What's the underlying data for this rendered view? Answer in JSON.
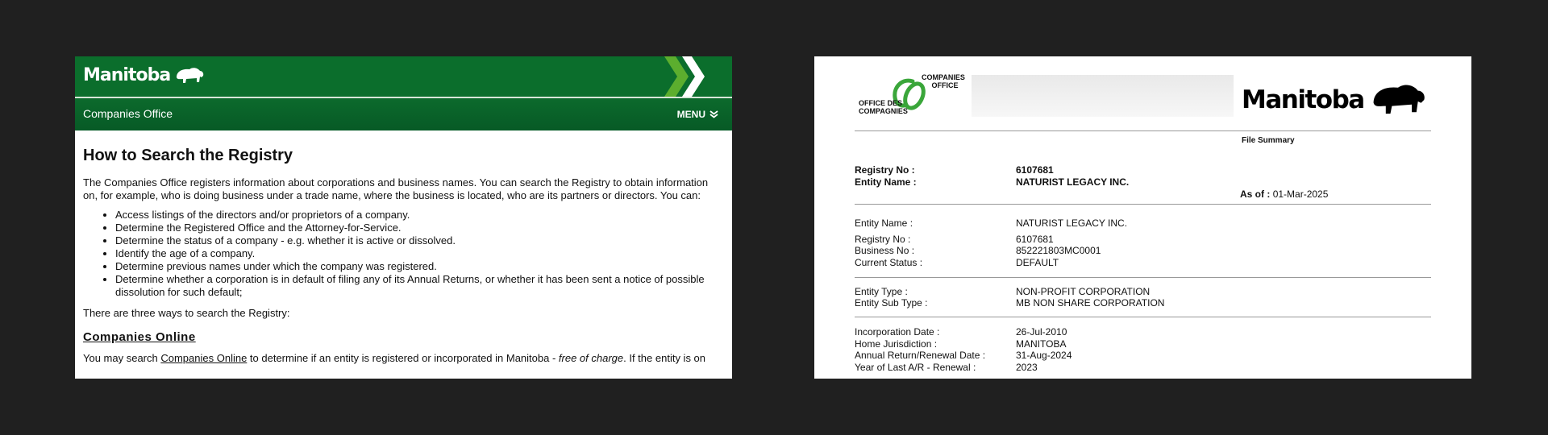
{
  "left": {
    "header": {
      "logo_text": "Manitoba",
      "section_title": "Companies Office",
      "menu_label": "MENU"
    },
    "heading": "How to Search the Registry",
    "intro": "The Companies Office registers information about corporations and business names. You can search the Registry to obtain information on, for example, who is doing business under a trade name, where the business is located, who are its partners or directors. You can:",
    "list": [
      "Access listings of the directors and/or proprietors of a company.",
      "Determine the Registered Office and the Attorney-for-Service.",
      "Determine the status of a company - e.g. whether it is active or dissolved.",
      "Identify the age of a company.",
      "Determine previous names under which the company was registered.",
      "Determine whether a corporation is in default of filing any of its Annual Returns, or whether it has been sent a notice of possible dissolution for such default;"
    ],
    "three_ways": "There are three ways to search the Registry:",
    "section_heading": "Companies Online",
    "online_para": {
      "before": "You may search ",
      "link": "Companies Online",
      "middle": " to determine if an entity is registered or incorporated in Manitoba - ",
      "italic": "free of charge",
      "after": ". If the entity is on"
    }
  },
  "right": {
    "logo": {
      "companies_office": "COMPANIES\nOFFICE",
      "office_des": "OFFICE DES\nCOMPAGNIES",
      "manitoba": "Manitoba"
    },
    "file_summary": "File Summary",
    "top": {
      "registry_label": "Registry No :",
      "registry_value": "6107681",
      "entity_label": "Entity Name :",
      "entity_value": "NATURIST LEGACY INC.",
      "as_of_label": "As of :",
      "as_of_value": "01-Mar-2025"
    },
    "details": {
      "entity_name_label": "Entity Name :",
      "entity_name_value": "NATURIST LEGACY INC.",
      "registry_label": "Registry No :",
      "registry_value": "6107681",
      "business_label": "Business No :",
      "business_value": "852221803MC0001",
      "status_label": "Current Status :",
      "status_value": "DEFAULT",
      "type_label": "Entity Type :",
      "type_value": "NON-PROFIT CORPORATION",
      "subtype_label": "Entity Sub Type :",
      "subtype_value": "MB NON SHARE CORPORATION",
      "inc_label": "Incorporation Date :",
      "inc_value": "26-Jul-2010",
      "juris_label": "Home Jurisdiction :",
      "juris_value": "MANITOBA",
      "ar_label": "Annual Return/Renewal Date :",
      "ar_value": "31-Aug-2024",
      "yar_label": "Year of Last A/R - Renewal :",
      "yar_value": "2023"
    }
  },
  "colors": {
    "manitoba_green": "#0b6e2c",
    "logo_green": "#3aa63a",
    "background": "#202020"
  }
}
